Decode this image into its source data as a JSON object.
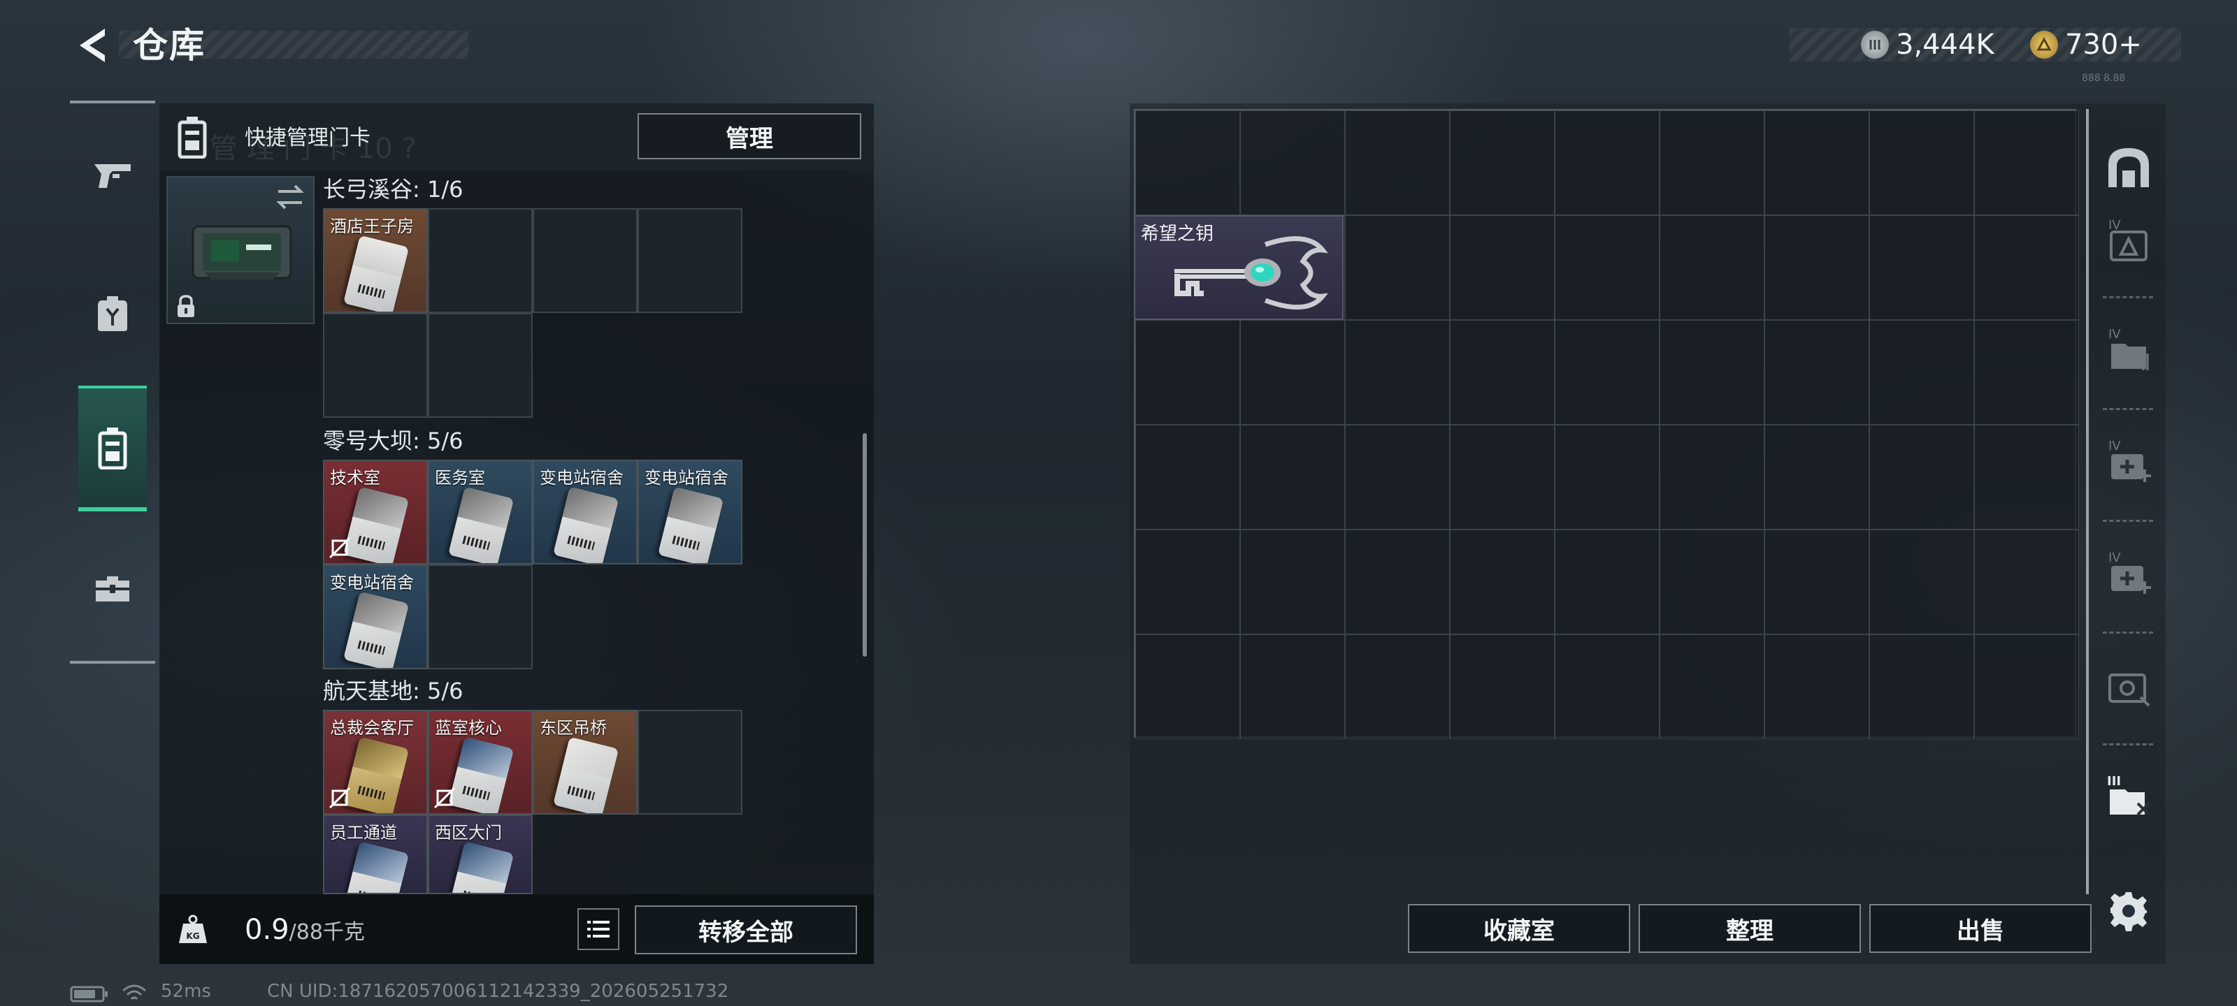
{
  "header": {
    "title": "仓库",
    "back_icon": "back-arrow-icon"
  },
  "currency": {
    "silver": "3,444K",
    "gold": "730+",
    "tag": "888 8.88"
  },
  "left_rail": {
    "tabs": [
      {
        "id": "weapons",
        "icon": "pistol-icon"
      },
      {
        "id": "equipment",
        "icon": "backpack-icon"
      },
      {
        "id": "keycards",
        "icon": "keycard-case-icon",
        "active": true
      },
      {
        "id": "toolbox",
        "icon": "toolbox-icon"
      }
    ]
  },
  "keycard_panel": {
    "header_title": "快捷管理门卡",
    "manage_label": "管理",
    "ghost": "管 理 门 卡 10 ?",
    "sections": [
      {
        "title": "长弓溪谷: 1/6",
        "cards": [
          {
            "label": "酒店王子房",
            "bg": "orange"
          }
        ]
      },
      {
        "title": "零号大坝: 5/6",
        "cards": [
          {
            "label": "技术室",
            "bg": "red",
            "no_drop": true
          },
          {
            "label": "医务室",
            "bg": "blue"
          },
          {
            "label": "变电站宿舍",
            "bg": "blue"
          },
          {
            "label": "变电站宿舍",
            "bg": "blue"
          },
          {
            "label": "变电站宿舍",
            "bg": "blue"
          }
        ]
      },
      {
        "title": "航天基地: 5/6",
        "cards": [
          {
            "label": "总裁会客厅",
            "bg": "gold",
            "no_drop": true
          },
          {
            "label": "蓝室核心",
            "bg": "purple",
            "no_drop": true
          },
          {
            "label": "东区吊桥",
            "bg": "orange"
          },
          {
            "label": "员工通道",
            "bg": "purple"
          },
          {
            "label": "西区大门",
            "bg": "purple"
          }
        ]
      }
    ]
  },
  "bottom": {
    "weight": "0.9",
    "weight_max": "/88千克",
    "transfer_all": "转移全部"
  },
  "stash": {
    "key_item_label": "希望之钥",
    "buttons": {
      "collection": "收藏室",
      "organize": "整理",
      "sell": "出售"
    }
  },
  "side_icons": [
    "safehouse-icon",
    "container-iv-icon",
    "container-iv-files-icon",
    "container-iv-medkit-icon",
    "container-iv-medkit-icon",
    "container-iv-camera-icon",
    "container-iii-icon",
    "gear-icon"
  ],
  "status": {
    "ping": "52ms",
    "uid": "CN UID:18716205700611214233­9_202605251732"
  }
}
